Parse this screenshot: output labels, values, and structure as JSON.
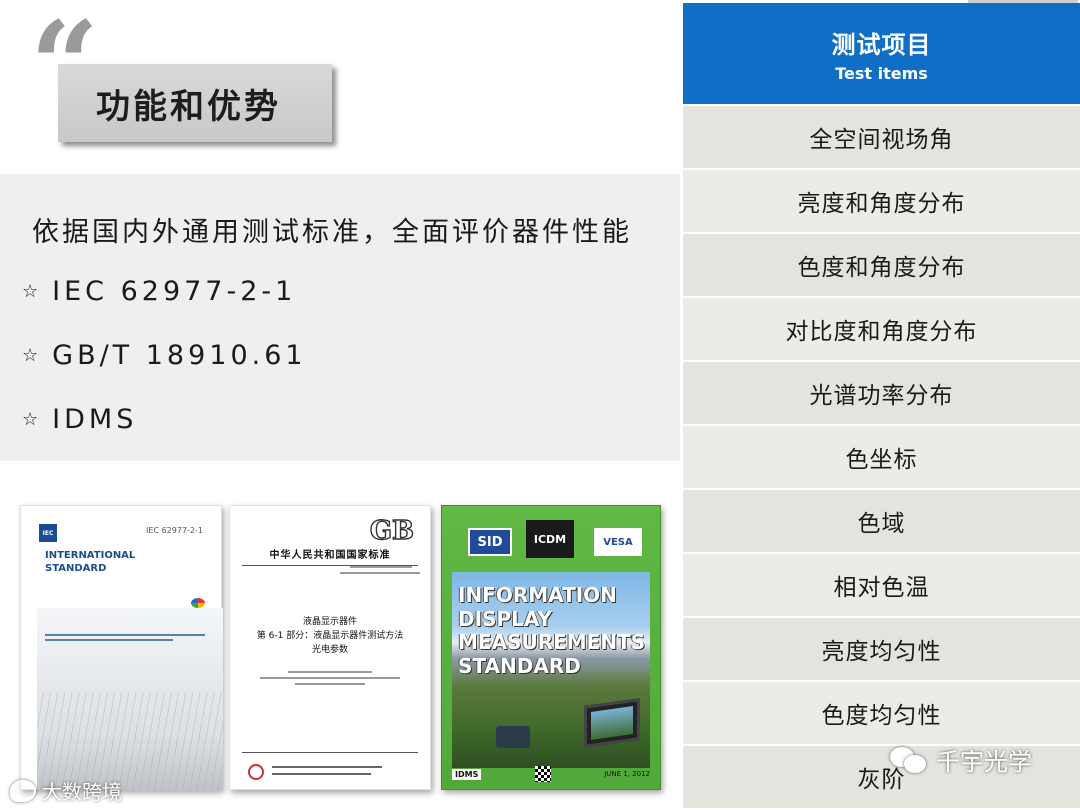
{
  "feature": {
    "quote_mark": "“",
    "title": "功能和优势"
  },
  "standards": {
    "intro": "依据国内外通用测试标准，全面评价器件性能",
    "bullet": "☆",
    "items": [
      "IEC 62977-2-1",
      "GB/T 18910.61",
      "IDMS"
    ]
  },
  "covers": {
    "iec": {
      "logo": "IEC",
      "number": "IEC 62977-2-1",
      "title": "INTERNATIONAL STANDARD",
      "accent": "#1a4e94"
    },
    "gb": {
      "logo": "GB",
      "header": "中华人民共和国国家标准",
      "title_lines": [
        "液晶显示器件",
        "第 6-1 部分：液晶显示器件测试方法",
        "光电参数"
      ]
    },
    "idms": {
      "badges": [
        "SID",
        "ICDM",
        "VESA"
      ],
      "title_lines": [
        "INFORMATION",
        "DISPLAY",
        "MEASUREMENTS",
        "STANDARD"
      ],
      "version": "IDMS",
      "date": "JUNE 1, 2012",
      "background": "#5cb340"
    }
  },
  "test_items": {
    "header_zh": "测试项目",
    "header_en": "Test items",
    "header_color": "#0f6fc6",
    "items": [
      "全空间视场角",
      "亮度和角度分布",
      "色度和角度分布",
      "对比度和角度分布",
      "光谱功率分布",
      "色坐标",
      "色域",
      "相对色温",
      "亮度均匀性",
      "色度均匀性",
      "灰阶"
    ]
  },
  "watermarks": {
    "left": "大数跨境",
    "right": "千宇光学",
    "left_icon": "weibo-icon",
    "right_icon": "wechat-icon"
  }
}
